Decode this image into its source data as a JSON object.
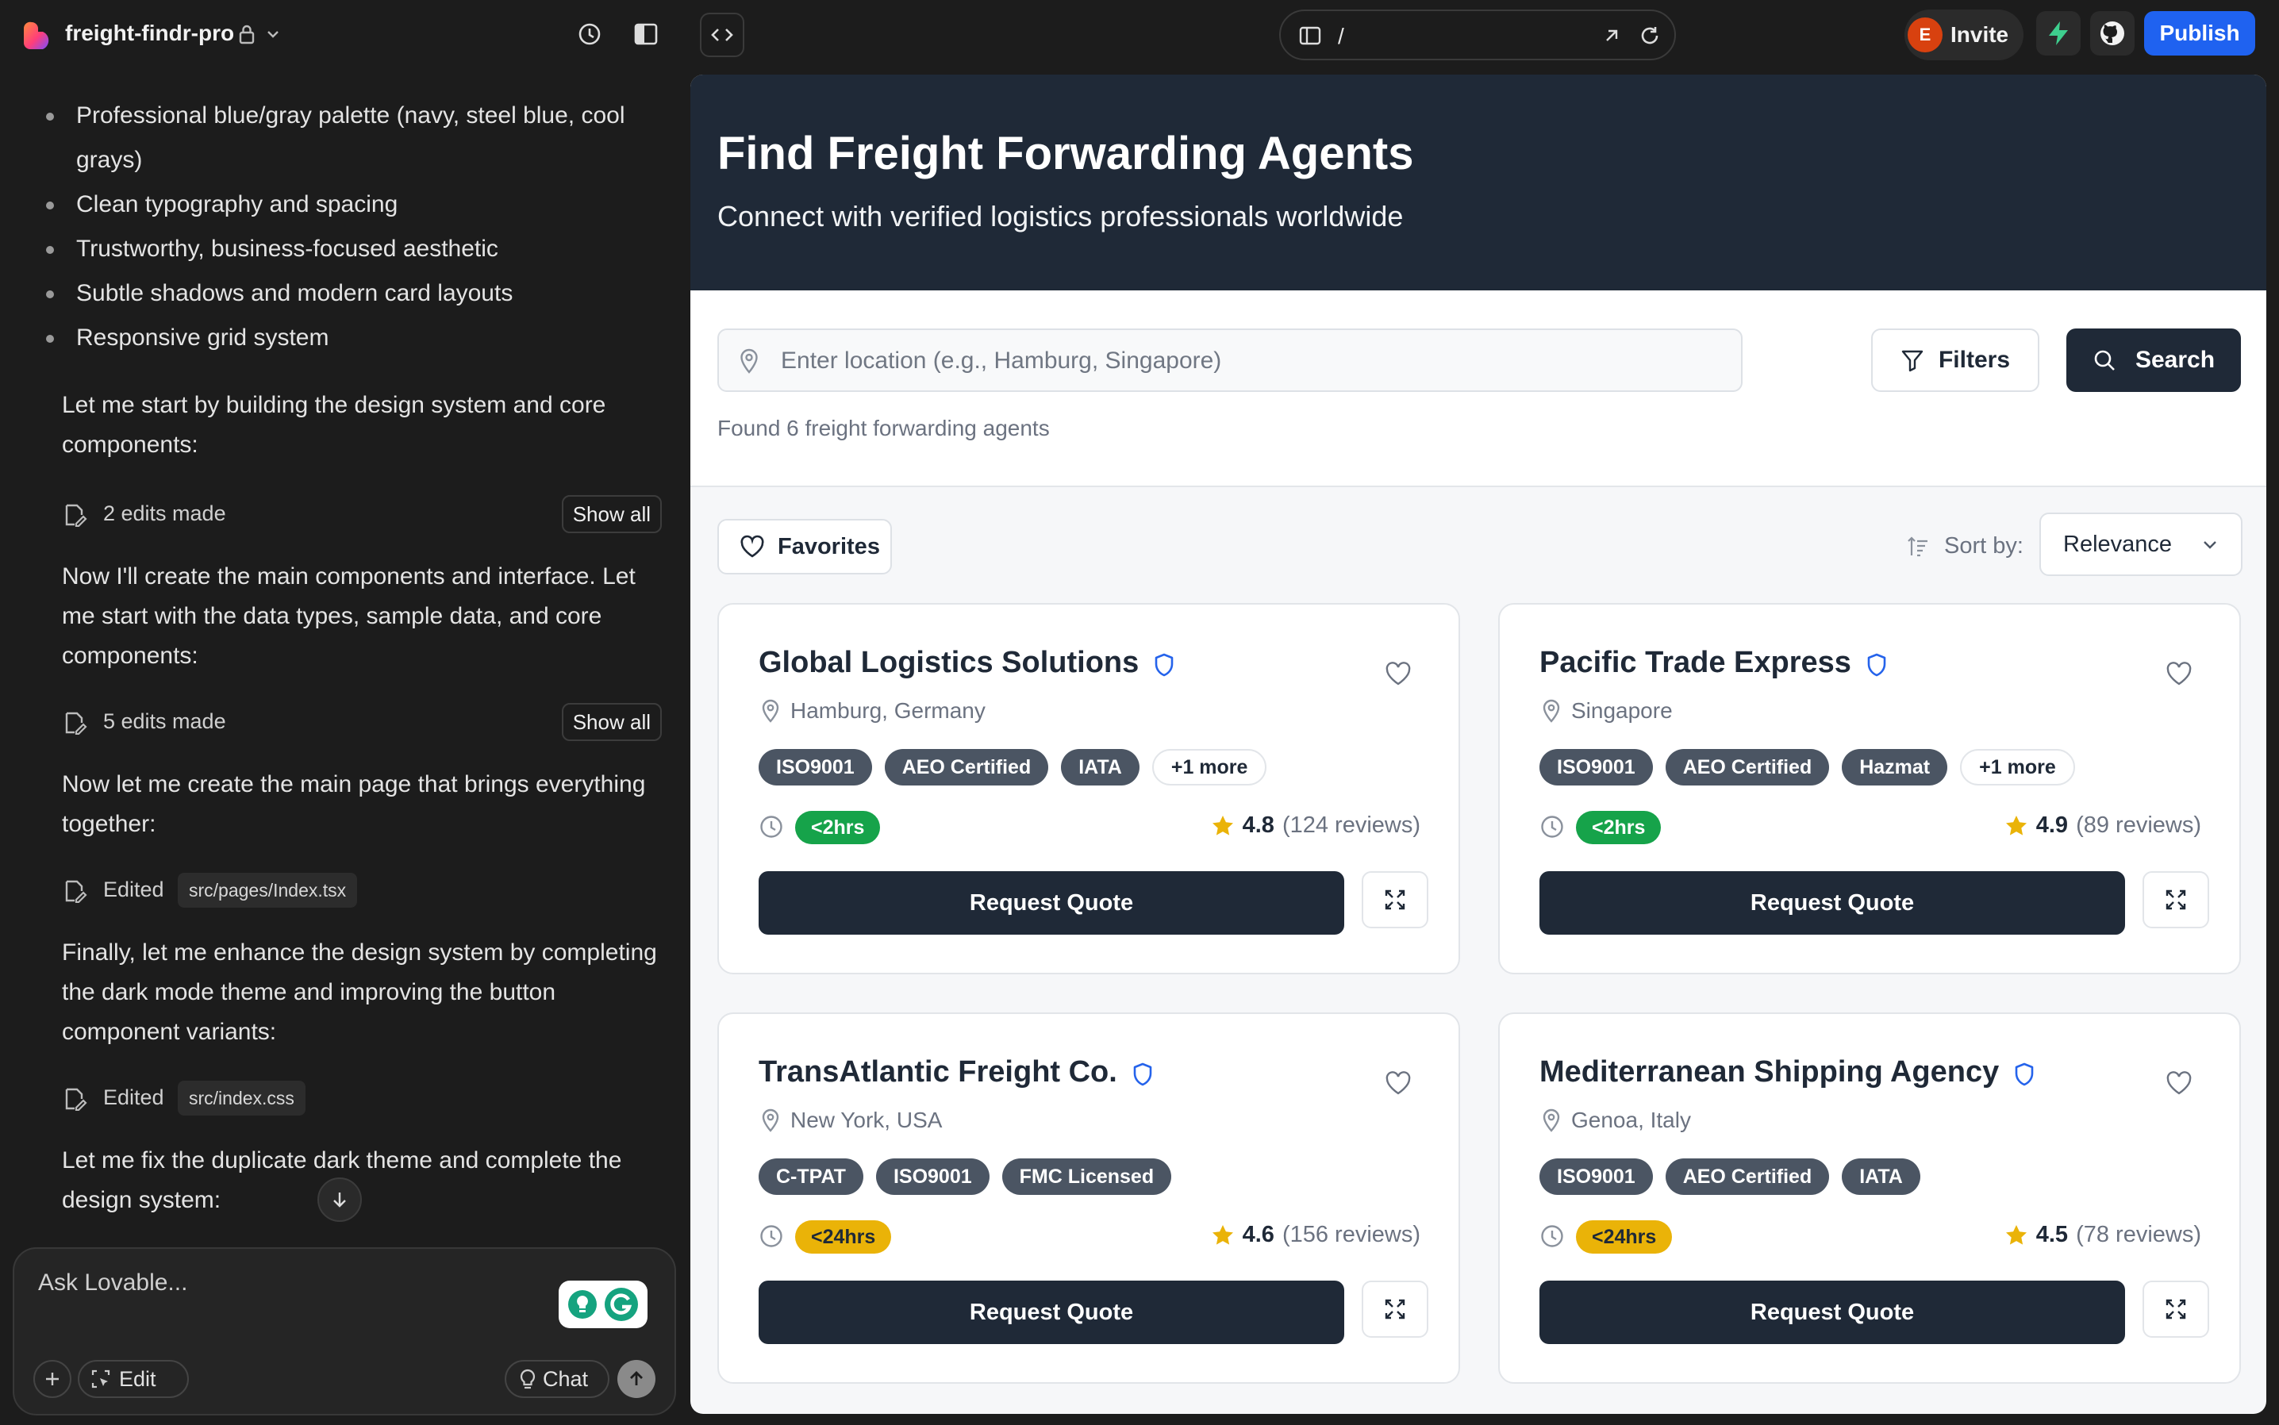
{
  "topbar": {
    "project_name": "freight-findr-pro",
    "url_path": "/",
    "invite_avatar": "E",
    "invite_label": "Invite",
    "publish_label": "Publish",
    "colors": {
      "publish": "#1f62f0",
      "avatar": "#d8410f",
      "bolt": "#3ecf8e"
    }
  },
  "chat": {
    "bullets": [
      "Professional blue/gray palette (navy, steel blue, cool grays)",
      "Clean typography and spacing",
      "Trustworthy, business-focused aesthetic",
      "Subtle shadows and modern card layouts",
      "Responsive grid system"
    ],
    "msg1": "Let me start by building the design system and core components:",
    "edits1": "2 edits made",
    "show_all": "Show all",
    "msg2": "Now I'll create the main components and interface. Let me start with the data types, sample data, and core components:",
    "edits2": "5 edits made",
    "msg3": "Now let me create the main page that brings everything together:",
    "edited_label": "Edited",
    "file1": "src/pages/Index.tsx",
    "msg4": "Finally, let me enhance the design system by completing the dark mode theme and improving the button component variants:",
    "file2": "src/index.css",
    "msg5": "Let me fix the duplicate dark theme and complete the design system:",
    "ask_placeholder": "Ask Lovable...",
    "edit_label": "Edit",
    "chat_label": "Chat"
  },
  "preview": {
    "hero_title": "Find Freight Forwarding Agents",
    "hero_subtitle": "Connect with verified logistics professionals worldwide",
    "search_placeholder": "Enter location (e.g., Hamburg, Singapore)",
    "filters_label": "Filters",
    "search_label": "Search",
    "found_text": "Found 6 freight forwarding agents",
    "favorites_label": "Favorites",
    "sort_label": "Sort by:",
    "sort_value": "Relevance",
    "request_label": "Request Quote",
    "agents": [
      {
        "name": "Global Logistics Solutions",
        "location": "Hamburg, Germany",
        "tags": [
          "ISO9001",
          "AEO Certified",
          "IATA"
        ],
        "more": "+1 more",
        "response": "<2hrs",
        "response_type": "fast",
        "rating": "4.8",
        "reviews": "(124 reviews)"
      },
      {
        "name": "Pacific Trade Express",
        "location": "Singapore",
        "tags": [
          "ISO9001",
          "AEO Certified",
          "Hazmat"
        ],
        "more": "+1 more",
        "response": "<2hrs",
        "response_type": "fast",
        "rating": "4.9",
        "reviews": "(89 reviews)"
      },
      {
        "name": "TransAtlantic Freight Co.",
        "location": "New York, USA",
        "tags": [
          "C-TPAT",
          "ISO9001",
          "FMC Licensed"
        ],
        "more": "",
        "response": "<24hrs",
        "response_type": "slow",
        "rating": "4.6",
        "reviews": "(156 reviews)"
      },
      {
        "name": "Mediterranean Shipping Agency",
        "location": "Genoa, Italy",
        "tags": [
          "ISO9001",
          "AEO Certified",
          "IATA"
        ],
        "more": "",
        "response": "<24hrs",
        "response_type": "slow",
        "rating": "4.5",
        "reviews": "(78 reviews)"
      }
    ],
    "colors": {
      "navy": "#1f2937",
      "fast": "#16a34a",
      "slow": "#eab308",
      "verified": "#2563eb",
      "star": "#eab308"
    }
  }
}
